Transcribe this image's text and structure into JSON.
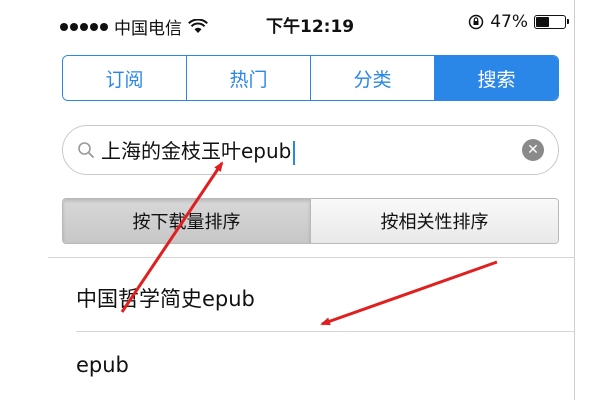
{
  "status_bar": {
    "carrier": "中国电信",
    "time": "下午12:19",
    "battery_percent": "47%",
    "battery_level": 0.47
  },
  "tabs": [
    {
      "label": "订阅",
      "active": false
    },
    {
      "label": "热门",
      "active": false
    },
    {
      "label": "分类",
      "active": false
    },
    {
      "label": "搜索",
      "active": true
    }
  ],
  "search": {
    "value": "上海的金枝玉叶epub"
  },
  "sort_options": [
    {
      "label": "按下载量排序",
      "active": true
    },
    {
      "label": "按相关性排序",
      "active": false
    }
  ],
  "results": [
    {
      "title": "中国哲学简史epub"
    },
    {
      "title": "epub"
    }
  ],
  "colors": {
    "accent": "#2a87e8",
    "annotation_arrow": "#e02020"
  }
}
